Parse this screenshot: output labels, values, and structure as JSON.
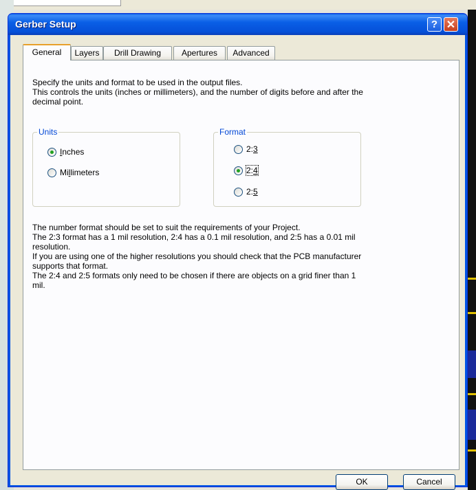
{
  "window": {
    "title": "Gerber Setup"
  },
  "tabs": [
    "General",
    "Layers",
    "Drill Drawing",
    "Apertures",
    "Advanced"
  ],
  "description": [
    "Specify the units and format to be used in the output files.",
    "This controls the units (inches or millimeters), and the number of digits before and after the",
    "decimal point."
  ],
  "units": {
    "legend": "Units",
    "options": [
      {
        "label_prefix": "",
        "accel": "I",
        "label_rest": "nches",
        "selected": true
      },
      {
        "label_prefix": "Mi",
        "accel": "l",
        "label_rest": "limeters",
        "selected": false
      }
    ]
  },
  "format": {
    "legend": "Format",
    "options": [
      {
        "label_prefix": "2:",
        "accel": "3",
        "label_rest": "",
        "selected": false
      },
      {
        "label_prefix": "2:",
        "accel": "4",
        "label_rest": "",
        "selected": true
      },
      {
        "label_prefix": "2:",
        "accel": "5",
        "label_rest": "",
        "selected": false
      }
    ]
  },
  "note": [
    "The number format should be set to suit the requirements of your Project.",
    "The 2:3 format has a 1 mil resolution, 2:4 has a 0.1 mil resolution, and 2:5 has a 0.01 mil",
    "resolution.",
    "If you are using one of the higher resolutions you should check that the PCB manufacturer",
    "supports that format.",
    "The 2:4 and 2:5 formats only need to be chosen if there are objects on a grid finer than 1",
    "mil."
  ],
  "buttons": {
    "ok": "OK",
    "cancel": "Cancel"
  },
  "icons": {
    "help": "help-icon",
    "close": "close-icon"
  },
  "colors": {
    "titlebar": "#0054e3",
    "legend": "#0046d5",
    "tab_highlight": "#e8a02a"
  }
}
